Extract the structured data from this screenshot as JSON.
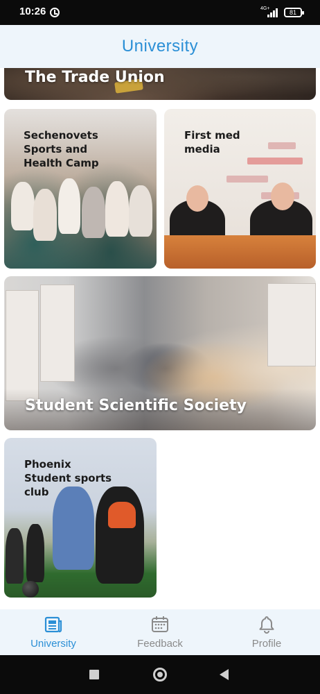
{
  "status_bar": {
    "time": "10:26",
    "network": "4G+",
    "battery": "81",
    "icons": [
      "alarm-icon",
      "signal-icon",
      "battery-icon"
    ]
  },
  "header": {
    "title": "University",
    "title_color": "#2b8fd6",
    "background": "#eef5fb"
  },
  "cards": [
    {
      "title": "The Trade Union"
    },
    {
      "title": "Sechenovets Sports and Health Camp"
    },
    {
      "title": "First med media"
    },
    {
      "title": "Student Scientific Society"
    },
    {
      "title": "Phoenix Student sports club"
    }
  ],
  "bottom_nav": {
    "items": [
      {
        "label": "University",
        "icon": "newspaper-icon",
        "active": true
      },
      {
        "label": "Feedback",
        "icon": "calendar-icon",
        "active": false
      },
      {
        "label": "Profile",
        "icon": "bell-icon",
        "active": false
      }
    ],
    "active_color": "#2b8fd6",
    "inactive_color": "#8a8a8a"
  },
  "system_nav": {
    "icons": [
      "recents-square-icon",
      "home-circle-icon",
      "back-triangle-icon"
    ]
  }
}
